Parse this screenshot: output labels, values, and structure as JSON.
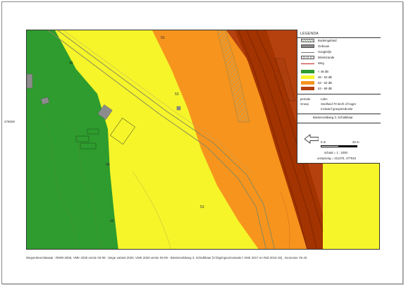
{
  "page": {
    "north_coordinate": "478000",
    "footer_text": "Wegverkeerslawaai - RMW-2006, VMK 2020 versie 03-09 - lange variant 2020, VMK 2020 versie 03-09 - Biesterveldweg 3, Schalkhaar [V:\\Dgringsomvieaste:\\ VMK 2017 en Rail 2010-15] , Geonoise V5.43"
  },
  "legend": {
    "title": "LEGENDA",
    "items": [
      {
        "label": "Bodemgebied",
        "swatch": "#ffffff",
        "pattern": "hatch"
      },
      {
        "label": "Gebouw",
        "swatch": "#8c8c8c",
        "pattern": "solid"
      },
      {
        "label": "Hoogtelijn",
        "swatch": "#ffffff",
        "pattern": "line"
      },
      {
        "label": "Minimirande",
        "swatch": "#ffffff",
        "pattern": "ticks"
      },
      {
        "label": "Weg",
        "swatch": "#ffffff",
        "pattern": "redline"
      },
      {
        "label": "< 48 dB",
        "swatch": "#2e9c2e",
        "pattern": "solid"
      },
      {
        "label": "48 - 53 dB",
        "swatch": "#f5f52a",
        "pattern": "solid"
      },
      {
        "label": "53 - 63 dB",
        "swatch": "#f7941d",
        "pattern": "solid"
      },
      {
        "label": "63 - 99 dB",
        "swatch": "#b5410f",
        "pattern": "solid"
      }
    ],
    "info": [
      {
        "key": "periode",
        "value": "Lden"
      },
      {
        "key": "Groep",
        "value": "Snelheid 70 km/h of hoger"
      },
      {
        "key": "",
        "value": "Inclusief groepsreductie"
      }
    ],
    "location": "Biesterveldweg 3, Schalkhaar",
    "scale_start": "0 m",
    "scale_end": "20 m",
    "scale_text": "schaal = 1 : 1000",
    "origin_text": "oorsprong = 211370, 477910"
  },
  "map_labels": [
    {
      "text": "48"
    },
    {
      "text": "48"
    },
    {
      "text": "48"
    },
    {
      "text": "53"
    },
    {
      "text": "53"
    },
    {
      "text": "53"
    }
  ],
  "colors": {
    "zone_lt48": "#2e9c2e",
    "zone_48_53": "#f5f52a",
    "zone_53_63": "#f7941d",
    "zone_63_99": "#b5410f",
    "zone_road": "#a33300"
  }
}
